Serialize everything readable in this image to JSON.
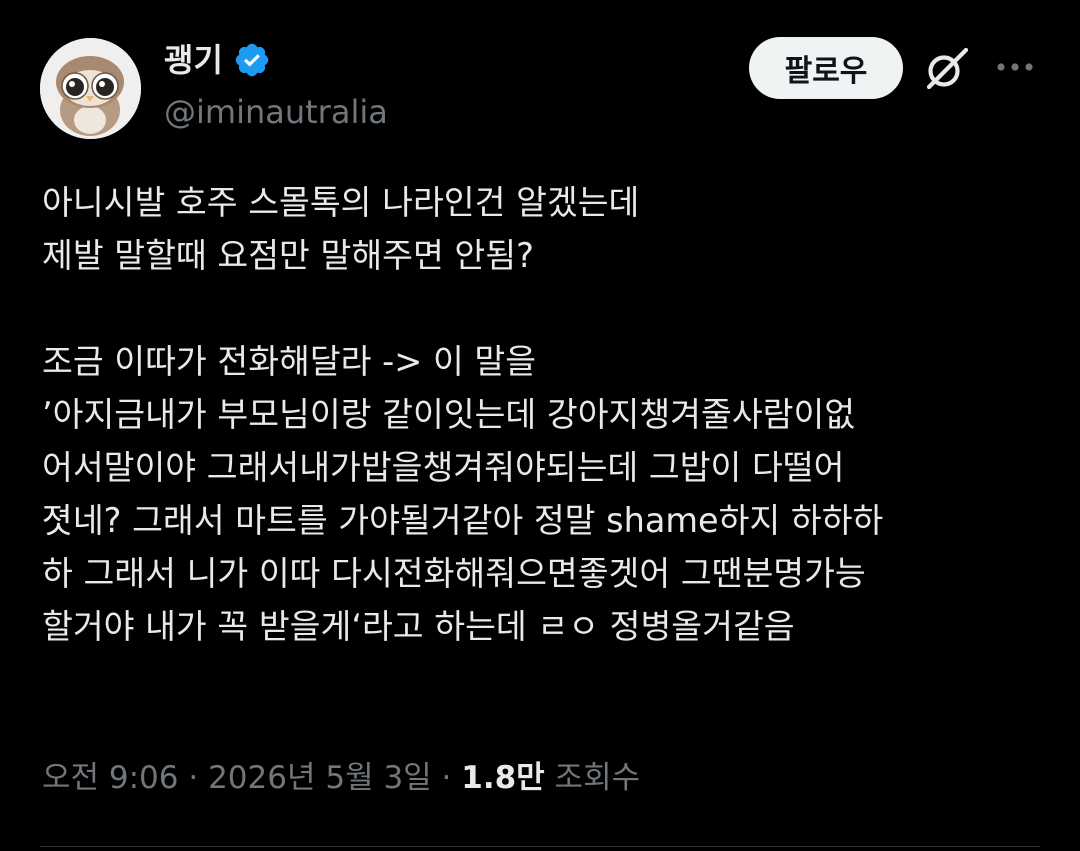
{
  "author": {
    "display_name": "괭기",
    "handle": "@iminautralia",
    "verified_icon": "verified-badge-icon",
    "avatar_icon": "plush-owl-avatar"
  },
  "actions": {
    "follow_label": "팔로우",
    "grok_icon": "grok-icon",
    "more_icon": "more-horizontal-icon"
  },
  "tweet": {
    "text": "아니시발 호주 스몰톡의 나라인건 알겠는데\n제발 말할때 요점만 말해주면 안됨?\n\n조금 이따가 전화해달라 -> 이 말을\n’아지금내가 부모님이랑 같이잇는데 강아지챙겨줄사람이없\n어서말이야 그래서내가밥을챙겨줘야되는데 그밥이 다떨어\n졋네? 그래서 마트를 가야될거같아 정말 shame하지 하하하\n하 그래서 니가 이따 다시전화해줘으면좋겟어 그땐분명가능\n할거야 내가 꼭 받을게‘라고 하는데 ㄹㅇ 정병올거같음"
  },
  "meta": {
    "time": "오전 9:06",
    "separator": " · ",
    "date": "2026년 5월 3일",
    "views_count": "1.8만",
    "views_label": "조회수"
  },
  "colors": {
    "background": "#000000",
    "text_primary": "#e7e9ea",
    "text_secondary": "#71767b",
    "verified_blue": "#1d9bf0",
    "follow_button_bg": "#eff3f4",
    "divider": "#2f3336"
  }
}
